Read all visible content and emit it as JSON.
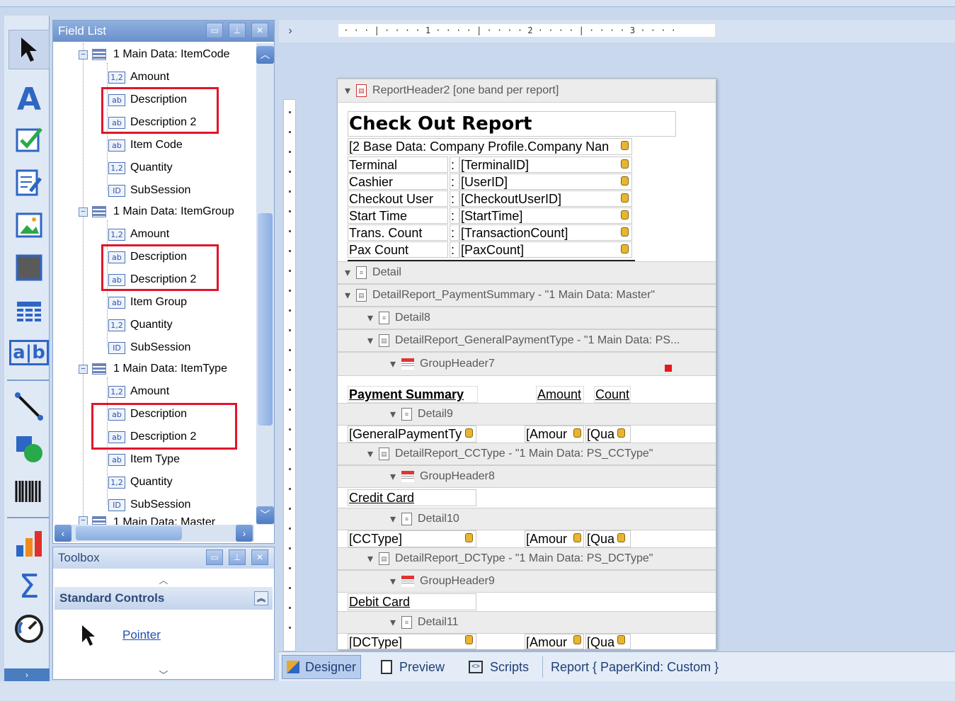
{
  "field_list": {
    "title": "Field List",
    "groups": [
      {
        "label": "1 Main Data:  ItemCode",
        "items": [
          {
            "icon": "1,2",
            "label": "Amount"
          },
          {
            "icon": "ab",
            "label": "Description"
          },
          {
            "icon": "ab",
            "label": "Description 2"
          },
          {
            "icon": "ab",
            "label": "Item Code"
          },
          {
            "icon": "1,2",
            "label": "Quantity"
          },
          {
            "icon": "ID",
            "label": "SubSession"
          }
        ]
      },
      {
        "label": "1 Main Data:  ItemGroup",
        "items": [
          {
            "icon": "1,2",
            "label": "Amount"
          },
          {
            "icon": "ab",
            "label": "Description"
          },
          {
            "icon": "ab",
            "label": "Description 2"
          },
          {
            "icon": "ab",
            "label": "Item Group"
          },
          {
            "icon": "1,2",
            "label": "Quantity"
          },
          {
            "icon": "ID",
            "label": "SubSession"
          }
        ]
      },
      {
        "label": "1 Main Data:  ItemType",
        "items": [
          {
            "icon": "1,2",
            "label": "Amount"
          },
          {
            "icon": "ab",
            "label": "Description"
          },
          {
            "icon": "ab",
            "label": "Description 2"
          },
          {
            "icon": "ab",
            "label": "Item Type"
          },
          {
            "icon": "1,2",
            "label": "Quantity"
          },
          {
            "icon": "ID",
            "label": "SubSession"
          }
        ]
      }
    ],
    "partial_next": "1 Main Data:  Master"
  },
  "toolbox": {
    "title": "Toolbox",
    "section": "Standard Controls",
    "pointer": "Pointer"
  },
  "ruler": {
    "marks": [
      "1",
      "2",
      "3"
    ]
  },
  "report": {
    "header_band": "ReportHeader2 [one band per report]",
    "title": "Check Out Report",
    "company": "[2 Base Data:  Company Profile.Company Nan",
    "rows": [
      {
        "label": "Terminal",
        "value": "[TerminalID]"
      },
      {
        "label": "Cashier",
        "value": "[UserID]"
      },
      {
        "label": "Checkout User",
        "value": "[CheckoutUserID]"
      },
      {
        "label": "Start Time",
        "value": "[StartTime]"
      },
      {
        "label": "Trans. Count",
        "value": "[TransactionCount]"
      },
      {
        "label": "Pax Count",
        "value": "[PaxCount]"
      }
    ],
    "colon": ":",
    "bands": {
      "detail": "Detail",
      "detail_payment": "DetailReport_PaymentSummary - \"1 Main Data:  Master\"",
      "detail8": "Detail8",
      "detail_general": "DetailReport_GeneralPaymentType - \"1 Main Data:  PS...",
      "gh7": "GroupHeader7",
      "detail9": "Detail9",
      "detail_cc": "DetailReport_CCType - \"1 Main Data:  PS_CCType\"",
      "gh8": "GroupHeader8",
      "detail10": "Detail10",
      "detail_dc": "DetailReport_DCType - \"1 Main Data:  PS_DCType\"",
      "gh9": "GroupHeader9",
      "detail11": "Detail11"
    },
    "payment_summary": "Payment Summary",
    "amount": "Amount",
    "count": "Count",
    "gpt_field": "[GeneralPaymentTy",
    "amount_field": "[Amour",
    "qty_field": "[Qua",
    "credit_card": "Credit Card",
    "cc_field": "[CCType]",
    "debit_card": "Debit Card",
    "dc_field": "[DCType]"
  },
  "status": {
    "designer": "Designer",
    "preview": "Preview",
    "scripts": "Scripts",
    "report_info": "Report { PaperKind: Custom }"
  }
}
